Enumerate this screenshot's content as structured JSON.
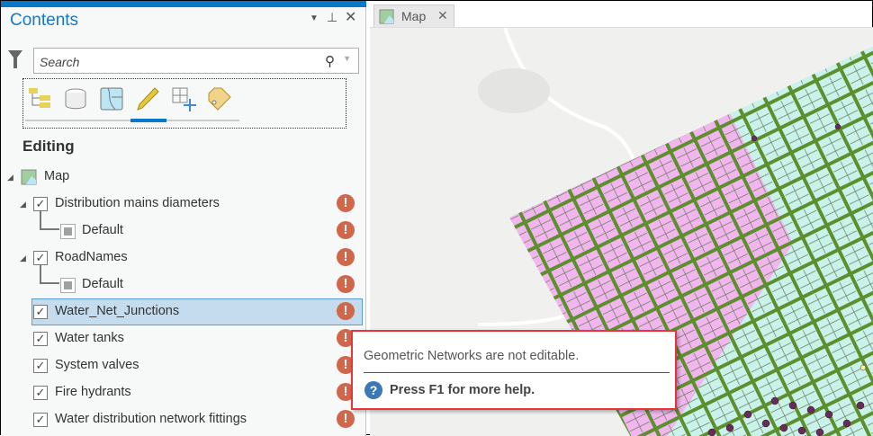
{
  "panel": {
    "title": "Contents",
    "search_placeholder": "Search",
    "section": "Editing"
  },
  "tree": [
    {
      "label": "Map",
      "type": "map"
    },
    {
      "label": "Distribution mains diameters",
      "type": "layer",
      "warn": true
    },
    {
      "label": "Default",
      "type": "symbol",
      "warn": true
    },
    {
      "label": "RoadNames",
      "type": "layer",
      "warn": true
    },
    {
      "label": "Default",
      "type": "symbol",
      "warn": true
    },
    {
      "label": "Water_Net_Junctions",
      "type": "layer",
      "warn": true,
      "selected": true
    },
    {
      "label": "Water tanks",
      "type": "layer",
      "warn": true
    },
    {
      "label": "System valves",
      "type": "layer",
      "warn": true
    },
    {
      "label": "Fire hydrants",
      "type": "layer",
      "warn": true
    },
    {
      "label": "Water distribution network fittings",
      "type": "layer",
      "warn": true
    }
  ],
  "map_tab": {
    "label": "Map"
  },
  "tooltip": {
    "message": "Geometric Networks are not editable.",
    "help": "Press F1 for more help."
  },
  "colors": {
    "accent": "#0a78c8",
    "warning": "#d0664a",
    "tooltip_border": "#e8353a"
  }
}
